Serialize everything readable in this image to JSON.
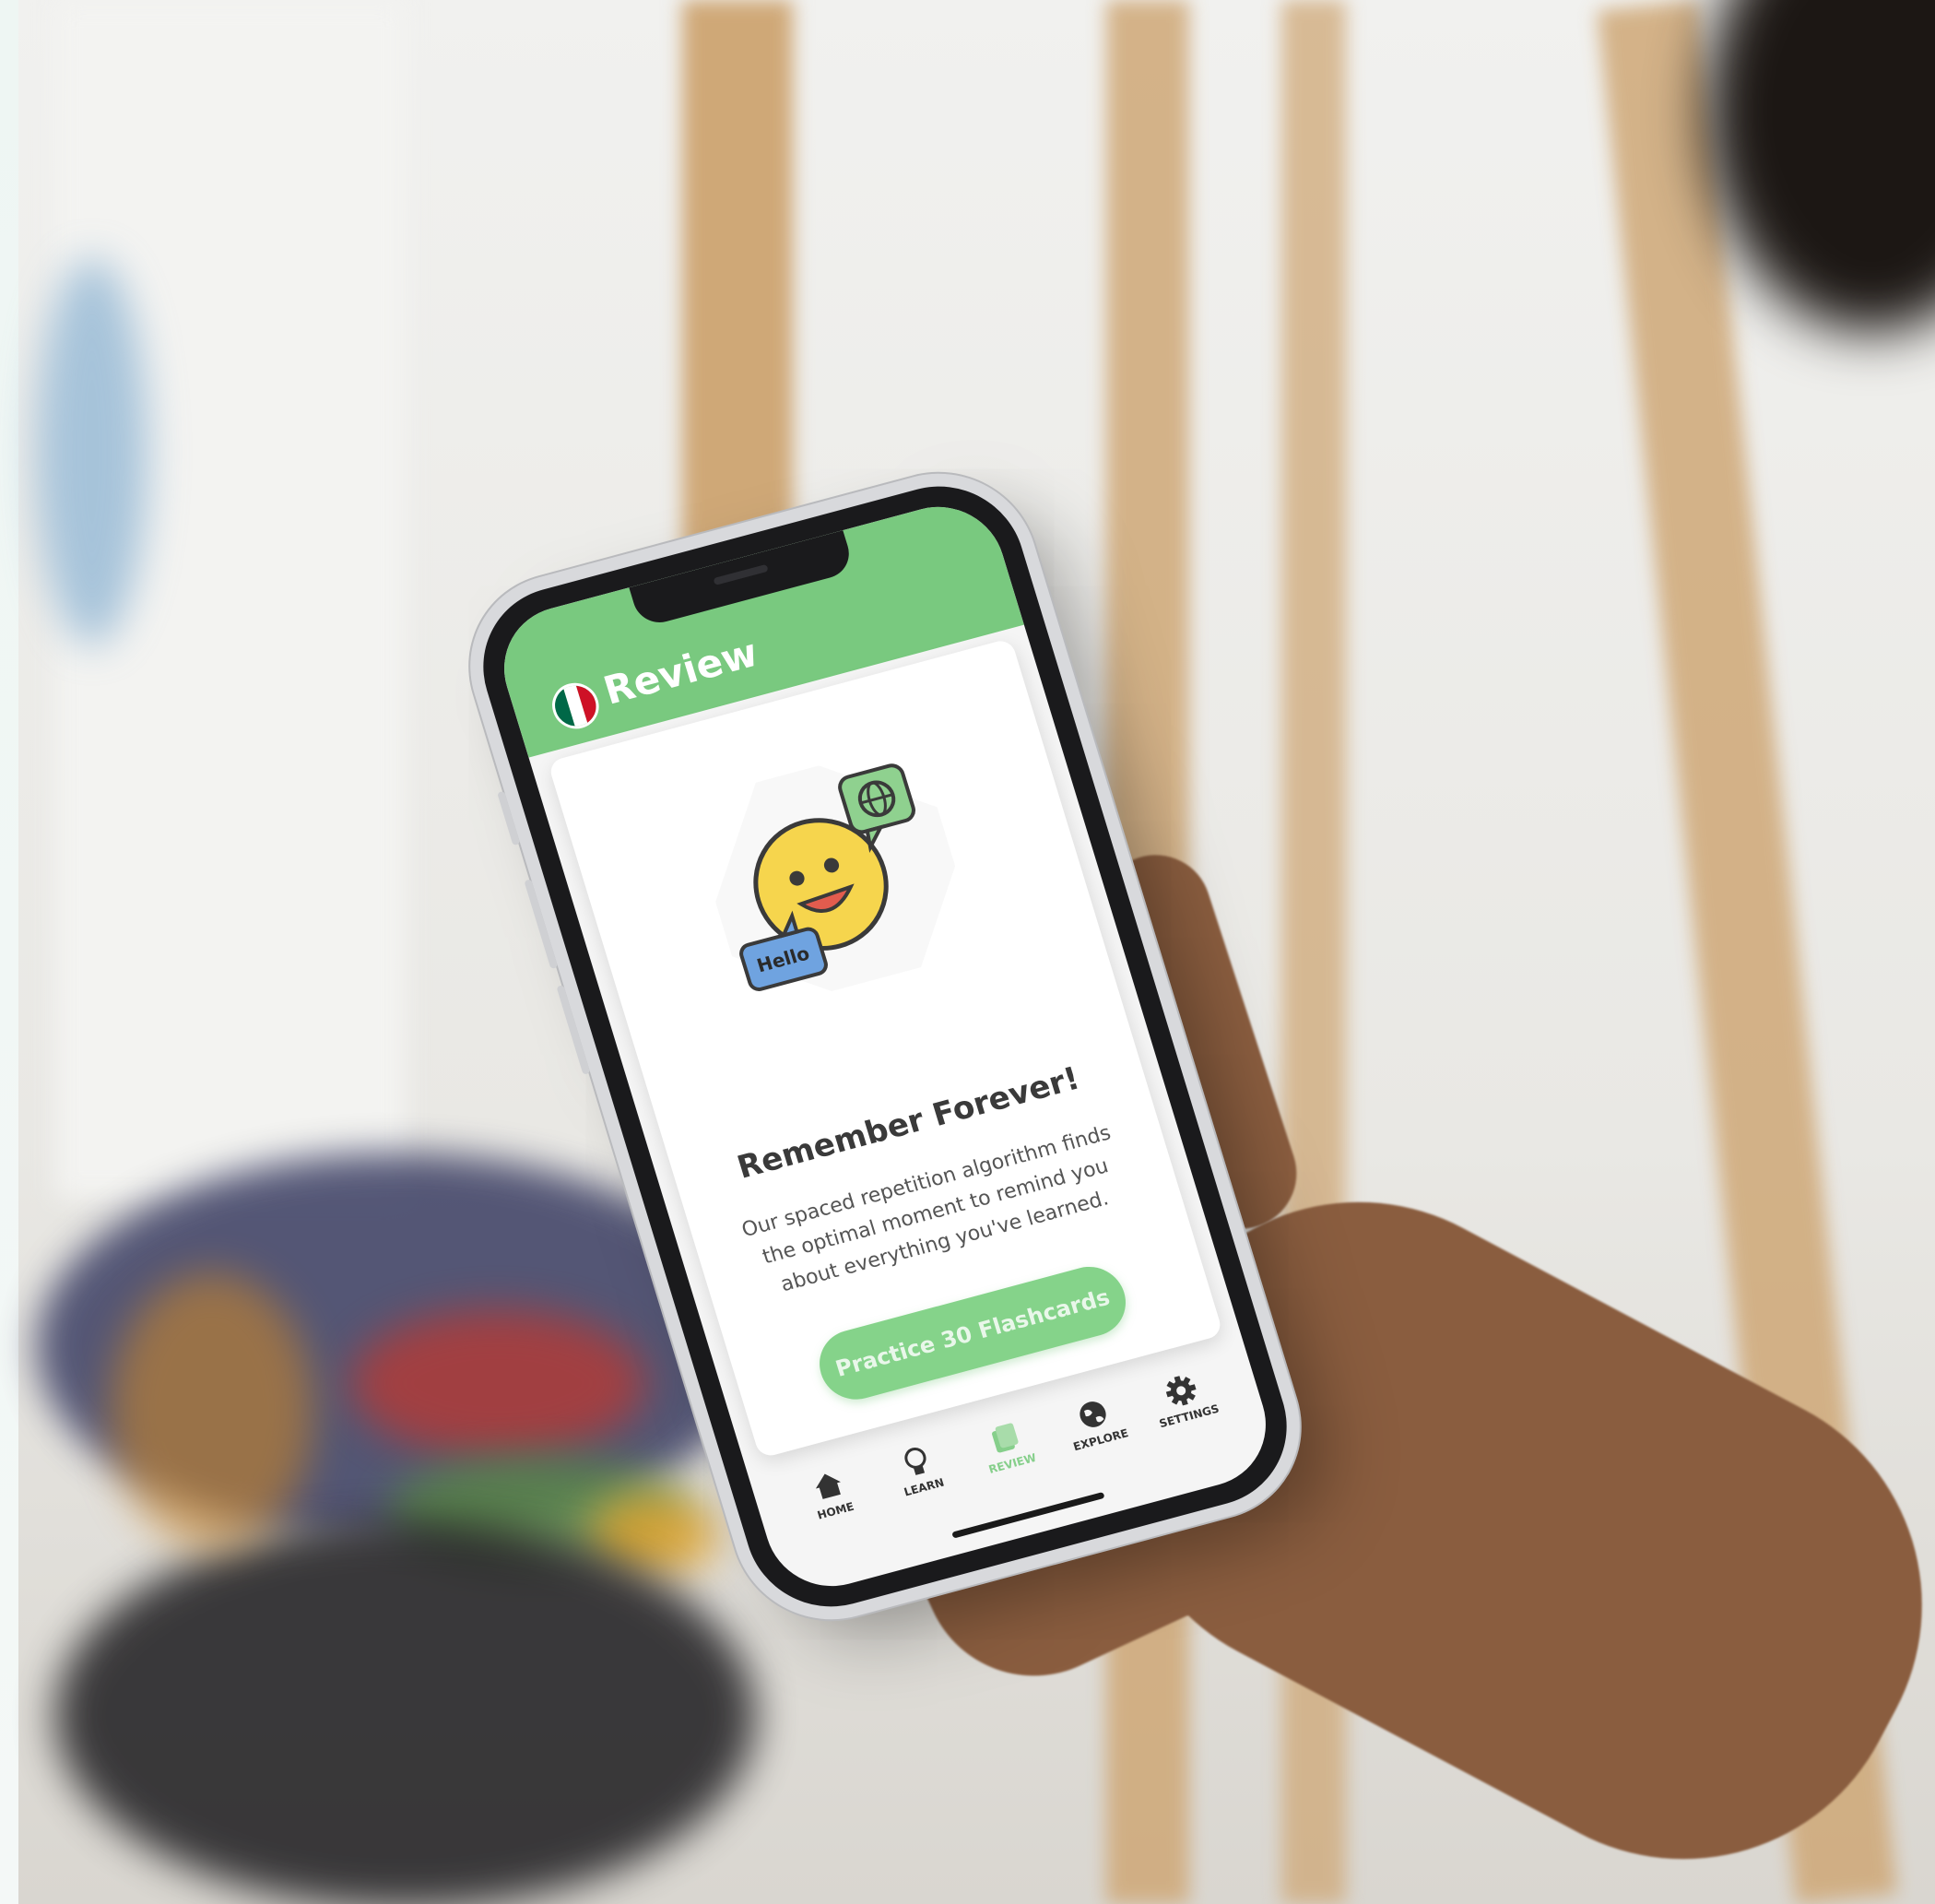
{
  "app": {
    "header_title": "Review",
    "flag_icon": "mexico-flag-icon"
  },
  "card": {
    "illustration_bubble_text": "Hello",
    "title": "Remember Forever!",
    "body": "Our spaced repetition algorithm finds the optimal moment to remind you about everything you've learned.",
    "button_label": "Practice 30 Flashcards"
  },
  "tabs": [
    {
      "label": "HOME",
      "icon": "home-icon",
      "active": false
    },
    {
      "label": "LEARN",
      "icon": "lightbulb-icon",
      "active": false
    },
    {
      "label": "REVIEW",
      "icon": "flashcards-icon",
      "active": true
    },
    {
      "label": "EXPLORE",
      "icon": "globe-icon",
      "active": false
    },
    {
      "label": "SETTINGS",
      "icon": "gear-icon",
      "active": false
    }
  ],
  "colors": {
    "brand_green": "#79c97f",
    "button_green": "#85d38a",
    "active_tab": "#86cf8b",
    "flag_green": "#006847",
    "flag_white": "#ffffff",
    "flag_red": "#ce1126"
  }
}
